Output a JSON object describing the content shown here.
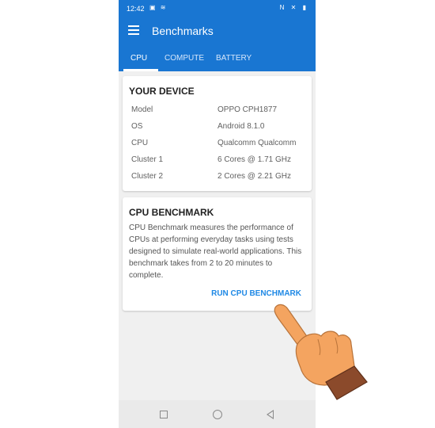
{
  "status_bar": {
    "time": "12:42",
    "left_icons": "▣ ≋",
    "right_icons": "N ✕ ▮"
  },
  "app_bar": {
    "title": "Benchmarks"
  },
  "tabs": [
    {
      "label": "CPU",
      "active": true
    },
    {
      "label": "COMPUTE",
      "active": false
    },
    {
      "label": "BATTERY",
      "active": false
    }
  ],
  "device_card": {
    "title": "YOUR DEVICE",
    "rows": [
      {
        "key": "Model",
        "value": "OPPO CPH1877"
      },
      {
        "key": "OS",
        "value": "Android 8.1.0"
      },
      {
        "key": "CPU",
        "value": "Qualcomm Qualcomm"
      },
      {
        "key": "Cluster 1",
        "value": "6 Cores @ 1.71 GHz"
      },
      {
        "key": "Cluster 2",
        "value": "2 Cores @ 2.21 GHz"
      }
    ]
  },
  "benchmark_card": {
    "title": "CPU BENCHMARK",
    "description": "CPU Benchmark measures the performance of CPUs at performing everyday tasks using tests designed to simulate real-world applications. This benchmark takes from 2 to 20 minutes to complete.",
    "button_label": "RUN CPU BENCHMARK"
  },
  "colors": {
    "primary": "#1976d2",
    "accent": "#1e88e5",
    "hand_skin": "#f4a460",
    "hand_cuff": "#8b4a2b"
  }
}
